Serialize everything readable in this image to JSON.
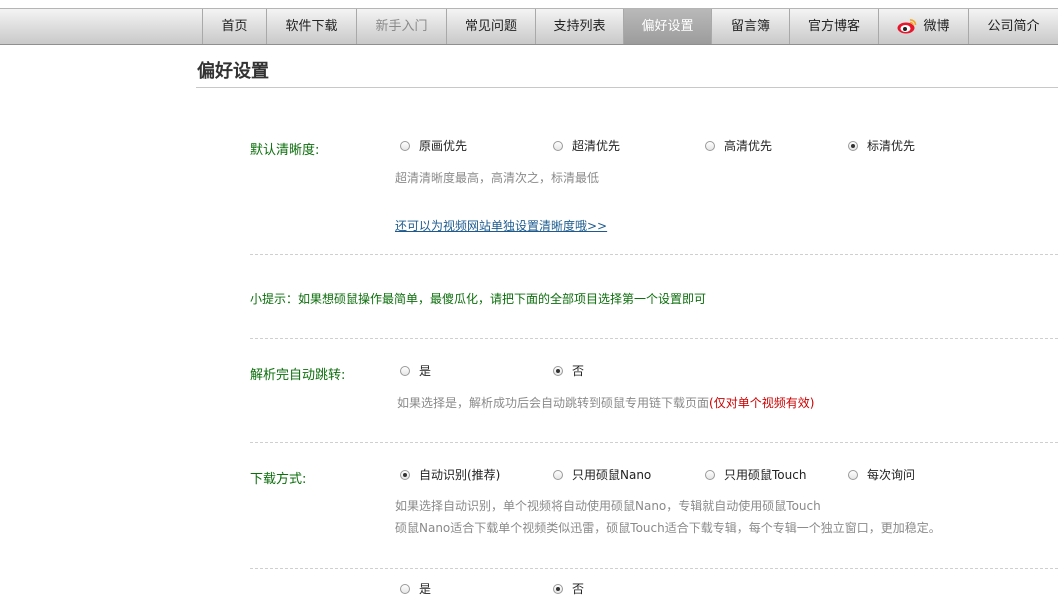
{
  "nav": {
    "items": [
      {
        "label": "首页"
      },
      {
        "label": "软件下载"
      },
      {
        "label": "新手入门"
      },
      {
        "label": "常见问题"
      },
      {
        "label": "支持列表"
      },
      {
        "label": "偏好设置"
      },
      {
        "label": "留言簿"
      },
      {
        "label": "官方博客"
      },
      {
        "label": "微博"
      },
      {
        "label": "公司简介"
      }
    ],
    "active": "偏好设置"
  },
  "page": {
    "title": "偏好设置"
  },
  "sections": {
    "definition": {
      "label": "默认清晰度:",
      "options": [
        "原画优先",
        "超清优先",
        "高清优先",
        "标清优先"
      ],
      "selected": "标清优先",
      "desc": "超清清晰度最高，高清次之，标清最低",
      "link": "还可以为视频网站单独设置清晰度哦>>"
    },
    "tip": "小提示：如果想硕鼠操作最简单，最傻瓜化，请把下面的全部项目选择第一个设置即可",
    "autojump": {
      "label": "解析完自动跳转:",
      "options": [
        "是",
        "否"
      ],
      "selected": "否",
      "desc": "如果选择是，解析成功后会自动跳转到硕鼠专用链下载页面",
      "desc_note": "(仅对单个视频有效)"
    },
    "download": {
      "label": "下载方式:",
      "options": [
        "自动识别(推荐)",
        "只用硕鼠Nano",
        "只用硕鼠Touch",
        "每次询问"
      ],
      "selected": "自动识别(推荐)",
      "desc1": "如果选择自动识别，单个视频将自动使用硕鼠Nano，专辑就自动使用硕鼠Touch",
      "desc2": "硕鼠Nano适合下载单个视频类似迅雷，硕鼠Touch适合下载专辑，每个专辑一个独立窗口，更加稳定。"
    },
    "next": {
      "options": [
        "是",
        "否"
      ],
      "selected": "否"
    }
  },
  "colors": {
    "label_green": "#0b6e0b",
    "link_blue": "#1d5b8e",
    "note_red": "#cc0000"
  }
}
